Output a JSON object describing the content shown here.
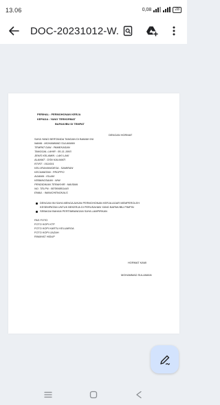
{
  "status_bar": {
    "time": "13.06",
    "net_speed": "0,08",
    "battery": "28"
  },
  "toolbar": {
    "title": "DOC-20231012-W...",
    "back_icon": "arrow-back-icon",
    "search_icon": "search-in-document-icon",
    "drive_icon": "add-to-drive-icon",
    "more_icon": "more-vert-icon"
  },
  "document": {
    "perihal": "PERIHAL : PERMOHONAN KERJA",
    "kepada": "KEPADA : YANG TERHORMAT",
    "recipient": "BAPAK/IBU DI TEMPAT",
    "salutation": "DENGAN HORMAT",
    "intro": "SAYA YANG BERTANDA TANGAN DI BAWAH INI",
    "fields": [
      "NAMA : MOHAMMAD SULAIMAN",
      "TEMPAT DAN : PAMEKASAN",
      "TANGGAL LAHIR : 05-11-1993",
      "JENIS KELAMIN : LAKI LAKI",
      "ALAMAT : DSN KALIMATI",
      "RT/RT : 001/001",
      "KELURAHAN/DESA : SAMIRAN",
      "KECAMATAN : PROPPO",
      "AGAMA : ISLAM",
      "KEBANGSAAN : WNI",
      "PENDIDIKAN TERAKHIR : MA/SMA",
      "NO. TELPN : 087866851440",
      "EMAIL : IMANCHENGKALS"
    ],
    "bullets": [
      "DENGAN INI SAYA MENGAJUKAN PERMOHONAN KERJA AGAR MEMPEROLEH",
      "KESEMPATAN UNTUK BEKERJA DI PERUSAHAN YANG BAPAK/IBU PIMPIN",
      "SEBAGAI BAHAN PERTIMBANGAN SAYA LAMPIRKAN"
    ],
    "attachments": [
      "PAS FOTO",
      "FOTO KOPI KTP",
      "FOTO KOPI KARTU KELUARGA",
      "FOTO KOPI IJAZAH",
      "RIWAYAT HIDUP"
    ],
    "closing": "HORMAT KAMI",
    "signer": "MOHAMMAD SULAIMAN"
  },
  "fab": {
    "icon": "edit-annotate-icon"
  },
  "nav_bar": {
    "recents_icon": "recents-icon",
    "home_icon": "home-icon",
    "back_icon": "nav-back-icon"
  },
  "colors": {
    "fab_bg": "#d3e3fd",
    "background": "#eceff3",
    "page": "#ffffff"
  }
}
